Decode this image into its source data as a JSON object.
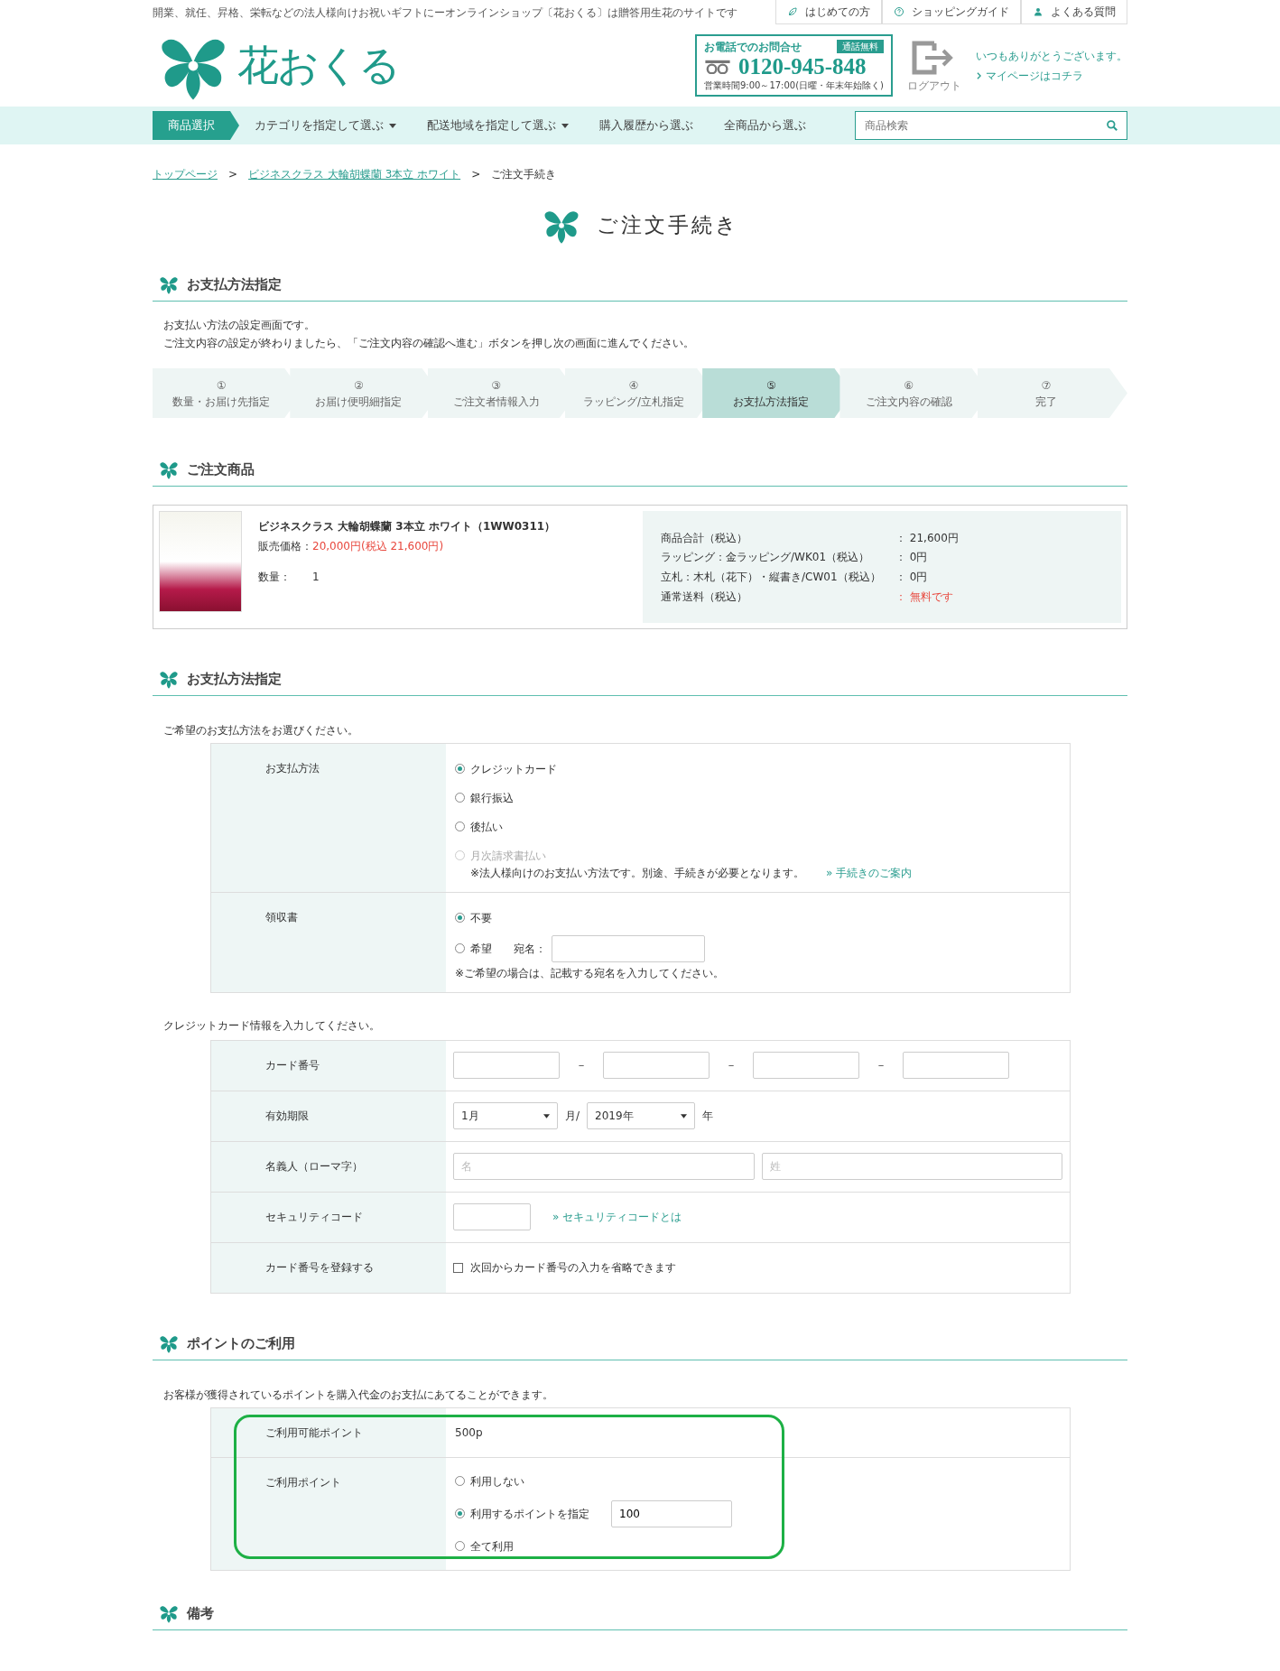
{
  "top_bar": {
    "tagline": "開業、就任、昇格、栄転などの法人様向けお祝いギフトにーオンラインショップ〔花おくる〕は贈答用生花のサイトです",
    "links": [
      {
        "kind": "leaf",
        "label": "はじめての方"
      },
      {
        "kind": "question",
        "label": "ショッピングガイド"
      },
      {
        "kind": "person",
        "label": "よくある質問"
      }
    ]
  },
  "header": {
    "logo_text": "花おくる",
    "phone": {
      "title": "お電話でのお問合せ",
      "badge": "通話無料",
      "number": "0120-945-848",
      "hours": "営業時間9:00～17:00(日曜・年末年始除く)"
    },
    "logout": "ログアウト",
    "greeting": "いつもありがとうございます。",
    "mypage": "マイページはコチラ"
  },
  "nav": {
    "items": [
      {
        "label": "商品選択",
        "selected": true,
        "dropdown": false
      },
      {
        "label": "カテゴリを指定して選ぶ",
        "selected": false,
        "dropdown": true
      },
      {
        "label": "配送地域を指定して選ぶ",
        "selected": false,
        "dropdown": true
      },
      {
        "label": "購入履歴から選ぶ",
        "selected": false,
        "dropdown": false
      },
      {
        "label": "全商品から選ぶ",
        "selected": false,
        "dropdown": false
      }
    ],
    "search_placeholder": "商品検索"
  },
  "breadcrumb": [
    {
      "label": "トップページ",
      "link": true
    },
    {
      "label": "ビジネスクラス 大輪胡蝶蘭 3本立 ホワイト",
      "link": true
    },
    {
      "label": "ご注文手続き",
      "link": false
    }
  ],
  "breadcrumb_separator": ">",
  "page_title": "ご注文手続き",
  "intro": {
    "heading": "お支払方法指定",
    "lines": [
      "お支払い方法の設定画面です。",
      "ご注文内容の設定が終わりましたら、「ご注文内容の確認へ進む」ボタンを押し次の画面に進んでください。"
    ]
  },
  "steps": [
    {
      "number": "①",
      "label": "数量・お届け先指定",
      "selected": false
    },
    {
      "number": "②",
      "label": "お届け便明細指定",
      "selected": false
    },
    {
      "number": "③",
      "label": "ご注文者情報入力",
      "selected": false
    },
    {
      "number": "④",
      "label": "ラッピング/立札指定",
      "selected": false
    },
    {
      "number": "⑤",
      "label": "お支払方法指定",
      "selected": true
    },
    {
      "number": "⑥",
      "label": "ご注文内容の確認",
      "selected": false
    },
    {
      "number": "⑦",
      "label": "完了",
      "selected": false
    }
  ],
  "order": {
    "heading": "ご注文商品",
    "product": {
      "name": "ビジネスクラス 大輪胡蝶蘭 3本立 ホワイト（1WW0311）",
      "price_label": "販売価格：",
      "price": "20,000円(税込 21,600円)",
      "quantity_label": "数量：",
      "quantity": "1"
    },
    "summary": [
      {
        "label": "商品合計（税込）",
        "value": "：  21,600円",
        "alert": false
      },
      {
        "label": "ラッピング：金ラッピング/WK01（税込）",
        "value": "：  0円",
        "alert": false
      },
      {
        "label": "立札：木札（花下）・縦書き/CW01（税込）",
        "value": "：  0円",
        "alert": false
      },
      {
        "label": "通常送料（税込）",
        "value": "：  無料です",
        "alert": true
      }
    ]
  },
  "payment": {
    "heading": "お支払方法指定",
    "instruction": "ご希望のお支払方法をお選びください。",
    "method": {
      "label": "お支払方法",
      "options": [
        {
          "label": "クレジットカード",
          "selected": true,
          "disabled": false
        },
        {
          "label": "銀行振込",
          "selected": false,
          "disabled": false
        },
        {
          "label": "後払い",
          "selected": false,
          "disabled": false
        },
        {
          "label": "月次請求書払い",
          "selected": false,
          "disabled": true
        }
      ],
      "note": "※法人様向けのお支払い方法です。別途、手続きが必要となります。",
      "link": "» 手続きのご案内"
    },
    "receipt": {
      "label": "領収書",
      "options": [
        {
          "label": "不要",
          "selected": true
        },
        {
          "label": "希望",
          "selected": false,
          "field_label": "宛名："
        }
      ],
      "note": "※ご希望の場合は、記載する宛名を入力してください。"
    }
  },
  "card": {
    "instruction": "クレジットカード情報を入力してください。",
    "rows": [
      {
        "kind": "number",
        "label": "カード番号",
        "separator": "－"
      },
      {
        "kind": "expiry",
        "label": "有効期限",
        "month": "1月",
        "month_unit": "月/",
        "year": "2019年",
        "year_unit": "年"
      },
      {
        "kind": "name",
        "label": "名義人（ローマ字）",
        "placeholders": [
          "名",
          "姓"
        ]
      },
      {
        "kind": "security",
        "label": "セキュリティコード",
        "link": "» セキュリティコードとは"
      },
      {
        "kind": "register",
        "label": "カード番号を登録する",
        "checked": false,
        "text": "次回からカード番号の入力を省略できます"
      }
    ]
  },
  "points": {
    "heading": "ポイントのご利用",
    "instruction": "お客様が獲得されているポイントを購入代金のお支払にあてることができます。",
    "highlighted": true,
    "available_label": "ご利用可能ポイント",
    "available": "500p",
    "use_label": "ご利用ポイント",
    "options": [
      {
        "label": "利用しない",
        "selected": false
      },
      {
        "label": "利用するポイントを指定",
        "selected": true,
        "value": "100"
      },
      {
        "label": "全て利用",
        "selected": false
      }
    ]
  },
  "remarks": {
    "heading": "備考"
  }
}
